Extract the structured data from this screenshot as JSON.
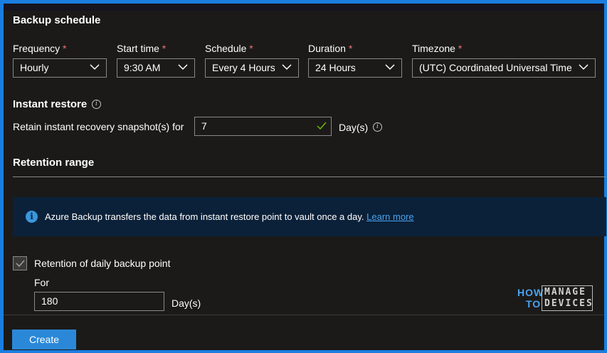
{
  "backup_schedule": {
    "heading": "Backup schedule",
    "frequency": {
      "label": "Frequency",
      "required": "*",
      "value": "Hourly"
    },
    "start_time": {
      "label": "Start time",
      "required": "*",
      "value": "9:30 AM"
    },
    "schedule": {
      "label": "Schedule",
      "required": "*",
      "value": "Every 4 Hours"
    },
    "duration": {
      "label": "Duration",
      "required": "*",
      "value": "24 Hours"
    },
    "timezone": {
      "label": "Timezone",
      "required": "*",
      "value": "(UTC) Coordinated Universal Time"
    }
  },
  "instant_restore": {
    "heading": "Instant restore",
    "retain_label": "Retain instant recovery snapshot(s) for",
    "retain_value": "7",
    "unit": "Day(s)",
    "valid_color": "#6bb700"
  },
  "retention_range": {
    "heading": "Retention range",
    "info_banner": {
      "icon": "info-icon",
      "text": "Azure Backup transfers the data from instant restore point to vault once a day.",
      "link": "Learn more"
    },
    "daily": {
      "checkbox_label": "Retention of daily backup point",
      "checked": true,
      "for_label": "For",
      "value": "180",
      "unit": "Day(s)"
    }
  },
  "footer": {
    "create_label": "Create"
  },
  "watermark": {
    "line1": "HOW",
    "line2": "TO",
    "box_line1": "MANAGE",
    "box_line2": "DEVICES"
  },
  "colors": {
    "accent": "#2b88d8",
    "frame": "#1a7ee0",
    "required": "#f1707b",
    "banner_bg": "#0b2139"
  }
}
